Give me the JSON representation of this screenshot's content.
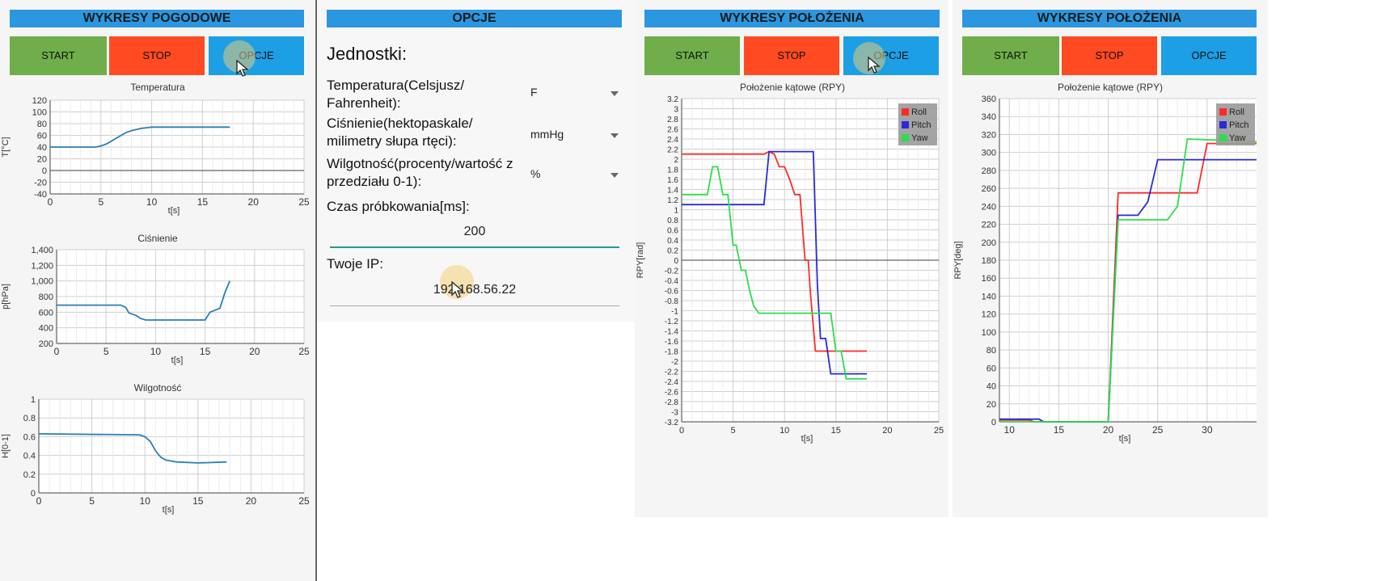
{
  "panel1": {
    "header": "WYKRESY POGODOWE",
    "buttons": {
      "start": "START",
      "stop": "STOP",
      "options": "OPCJE"
    }
  },
  "panel2": {
    "header": "OPCJE",
    "units_heading": "Jednostki:",
    "temperature_label": [
      "Temperatura(Celsjusz/",
      "Fahrenheit):"
    ],
    "temperature_value": "F",
    "pressure_label": [
      "Ciśnienie(hektopaskale/",
      "milimetry słupa rtęci):"
    ],
    "pressure_value": "mmHg",
    "humidity_label": [
      "Wilgotność(procenty/wartość z",
      "przedziału 0-1):"
    ],
    "humidity_value": "%",
    "sampling_label": "Czas próbkowania[ms]:",
    "sampling_value": "200",
    "ip_label": "Twoje IP:",
    "ip_value": "192.168.56.22"
  },
  "panel3": {
    "header": "WYKRESY POŁOŻENIA",
    "buttons": {
      "start": "START",
      "stop": "STOP",
      "options": "OPCJE"
    }
  },
  "panel4": {
    "header": "WYKRESY POŁOŻENIA",
    "buttons": {
      "start": "START",
      "stop": "STOP",
      "options": "OPCJE"
    }
  },
  "colors": {
    "header": "#2b97e0",
    "start": "#6fae4a",
    "stop": "#ff4a22",
    "options": "#1d9fe6",
    "line": "#2a7fb8",
    "roll": "#ff2a2a",
    "pitch": "#2a2ad8",
    "yaw": "#2adf4a"
  },
  "chart_data": [
    {
      "id": "temp",
      "type": "line",
      "title": "Temperatura",
      "xlabel": "t[s]",
      "ylabel": "T[°C]",
      "xlim": [
        0,
        25
      ],
      "ylim": [
        -40,
        120
      ],
      "xticks": [
        "0",
        "5",
        "10",
        "15",
        "20",
        "25"
      ],
      "yticks": [
        "-40",
        "-20",
        "0",
        "20",
        "40",
        "60",
        "80",
        "100",
        "120"
      ],
      "series": [
        {
          "color": "#2a7fb8",
          "x": [
            0,
            4.5,
            5,
            5.5,
            6,
            6.5,
            7,
            7.5,
            8,
            8.5,
            9,
            9.5,
            10,
            12,
            15,
            17.7
          ],
          "y": [
            40,
            40,
            42,
            45,
            50,
            55,
            60,
            65,
            68,
            70,
            72,
            73,
            74,
            74,
            74,
            74
          ]
        }
      ]
    },
    {
      "id": "pres",
      "type": "line",
      "title": "Ciśnienie",
      "xlabel": "t[s]",
      "ylabel": "p[hPa]",
      "xlim": [
        0,
        25
      ],
      "ylim": [
        200,
        1400
      ],
      "xticks": [
        "0",
        "5",
        "10",
        "15",
        "20",
        "25"
      ],
      "yticks": [
        "200",
        "400",
        "600",
        "800",
        "1,000",
        "1,200",
        "1,400"
      ],
      "series": [
        {
          "color": "#2a7fb8",
          "x": [
            0,
            6.5,
            7,
            7.3,
            8,
            8.5,
            9,
            12,
            15,
            15.5,
            16.5,
            17,
            17.5
          ],
          "y": [
            690,
            690,
            660,
            590,
            560,
            520,
            500,
            500,
            500,
            600,
            650,
            850,
            1000
          ]
        }
      ]
    },
    {
      "id": "hum",
      "type": "line",
      "title": "Wilgotność",
      "xlabel": "t[s]",
      "ylabel": "H[0-1]",
      "xlim": [
        0,
        25
      ],
      "ylim": [
        0,
        1
      ],
      "xticks": [
        "0",
        "5",
        "10",
        "15",
        "20",
        "25"
      ],
      "yticks": [
        "0",
        "0.2",
        "0.4",
        "0.6",
        "0.8",
        "1"
      ],
      "series": [
        {
          "color": "#2a7fb8",
          "x": [
            0,
            9.5,
            10,
            10.5,
            11,
            11.5,
            12,
            13,
            15,
            17.7
          ],
          "y": [
            0.63,
            0.62,
            0.6,
            0.55,
            0.45,
            0.38,
            0.35,
            0.33,
            0.32,
            0.33
          ]
        }
      ]
    },
    {
      "id": "rpy1",
      "type": "line",
      "title": "Położenie kątowe (RPY)",
      "xlabel": "t[s]",
      "ylabel": "RPY[rad]",
      "xlim": [
        0,
        25
      ],
      "ylim": [
        -3.2,
        3.2
      ],
      "xticks": [
        "0",
        "5",
        "10",
        "15",
        "20",
        "25"
      ],
      "yticks": [
        "-3.2",
        "-3",
        "-2.8",
        "-2.6",
        "-2.4",
        "-2.2",
        "-2",
        "-1.8",
        "-1.6",
        "-1.4",
        "-1.2",
        "-1",
        "-0.8",
        "-0.6",
        "-0.4",
        "-0.2",
        "0",
        "0.2",
        "0.4",
        "0.6",
        "0.8",
        "1",
        "1.2",
        "1.4",
        "1.6",
        "1.8",
        "2",
        "2.2",
        "2.4",
        "2.6",
        "2.8",
        "3",
        "3.2"
      ],
      "legend": [
        "Roll",
        "Pitch",
        "Yaw"
      ],
      "series": [
        {
          "name": "Roll",
          "color": "#ff2a2a",
          "x": [
            0,
            8,
            8.5,
            9,
            9.5,
            10,
            10.5,
            11,
            11.5,
            12,
            12.3,
            12.5,
            13,
            16,
            18
          ],
          "y": [
            2.1,
            2.1,
            2.15,
            2.1,
            1.85,
            1.85,
            1.6,
            1.3,
            1.3,
            0,
            0,
            -0.6,
            -1.8,
            -1.8,
            -1.8
          ]
        },
        {
          "name": "Pitch",
          "color": "#2a2ad8",
          "x": [
            0,
            8,
            8.5,
            9,
            12.8,
            13.2,
            13.5,
            14,
            14.5,
            15,
            18
          ],
          "y": [
            1.1,
            1.1,
            2.15,
            2.15,
            2.15,
            -0.5,
            -1.55,
            -1.55,
            -2.25,
            -2.25,
            -2.25
          ]
        },
        {
          "name": "Yaw",
          "color": "#2adf4a",
          "x": [
            0,
            2.5,
            3,
            3.5,
            4,
            4.5,
            5,
            5.3,
            5.8,
            6.2,
            6.6,
            7,
            7.5,
            14.5,
            15,
            15.5,
            16,
            16.5,
            18
          ],
          "y": [
            1.3,
            1.3,
            1.85,
            1.85,
            1.3,
            1.3,
            0.3,
            0.3,
            -0.2,
            -0.2,
            -0.6,
            -0.9,
            -1.05,
            -1.05,
            -1.8,
            -1.8,
            -2.35,
            -2.35,
            -2.35
          ]
        }
      ]
    },
    {
      "id": "rpy2",
      "type": "line",
      "title": "Położenie kątowe (RPY)",
      "xlabel": "t[s]",
      "ylabel": "RPY[deg]",
      "xlim": [
        9,
        35
      ],
      "ylim": [
        0,
        360
      ],
      "xticks": [
        "10",
        "15",
        "20",
        "25",
        "30"
      ],
      "yticks": [
        "0",
        "20",
        "40",
        "60",
        "80",
        "100",
        "120",
        "140",
        "160",
        "180",
        "200",
        "220",
        "240",
        "260",
        "280",
        "300",
        "320",
        "340",
        "360"
      ],
      "legend": [
        "Roll",
        "Pitch",
        "Yaw"
      ],
      "series": [
        {
          "name": "Roll",
          "color": "#ff2a2a",
          "x": [
            9,
            12,
            12.5,
            20,
            21,
            29,
            30,
            35
          ],
          "y": [
            2,
            2,
            0,
            0,
            255,
            255,
            310,
            310
          ]
        },
        {
          "name": "Pitch",
          "color": "#2a2ad8",
          "x": [
            9,
            13,
            13.5,
            20,
            21,
            23,
            24,
            25,
            35
          ],
          "y": [
            3,
            3,
            0,
            0,
            230,
            230,
            245,
            292,
            292
          ]
        },
        {
          "name": "Yaw",
          "color": "#2adf4a",
          "x": [
            9,
            12,
            20,
            21,
            25,
            26,
            27,
            28,
            35
          ],
          "y": [
            0,
            0,
            0,
            225,
            225,
            225,
            240,
            315,
            312
          ]
        }
      ]
    }
  ]
}
